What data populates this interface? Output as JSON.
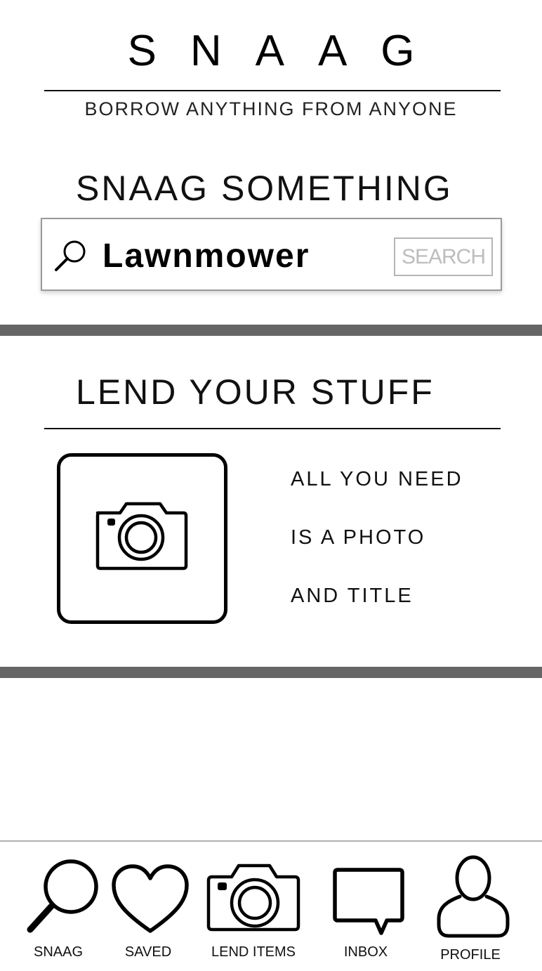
{
  "header": {
    "brand": "SNAAG",
    "tagline": "BORROW ANYTHING FROM ANYONE"
  },
  "search_section": {
    "title": "SNAAG SOMETHING",
    "input_value": "Lawnmower",
    "search_button": "SEARCH"
  },
  "lend_section": {
    "title": "LEND YOUR STUFF",
    "lines": [
      "ALL YOU NEED",
      "IS A PHOTO",
      "AND TITLE"
    ]
  },
  "nav": {
    "items": [
      {
        "label": "SNAAG",
        "icon": "search-icon"
      },
      {
        "label": "SAVED",
        "icon": "heart-icon"
      },
      {
        "label": "LEND ITEMS",
        "icon": "camera-icon"
      },
      {
        "label": "INBOX",
        "icon": "chat-bubble-icon"
      },
      {
        "label": "PROFILE",
        "icon": "user-icon"
      }
    ]
  },
  "colors": {
    "divider": "#666666",
    "search_border": "#9a9a9a",
    "search_button_text": "#bdbdbd"
  }
}
